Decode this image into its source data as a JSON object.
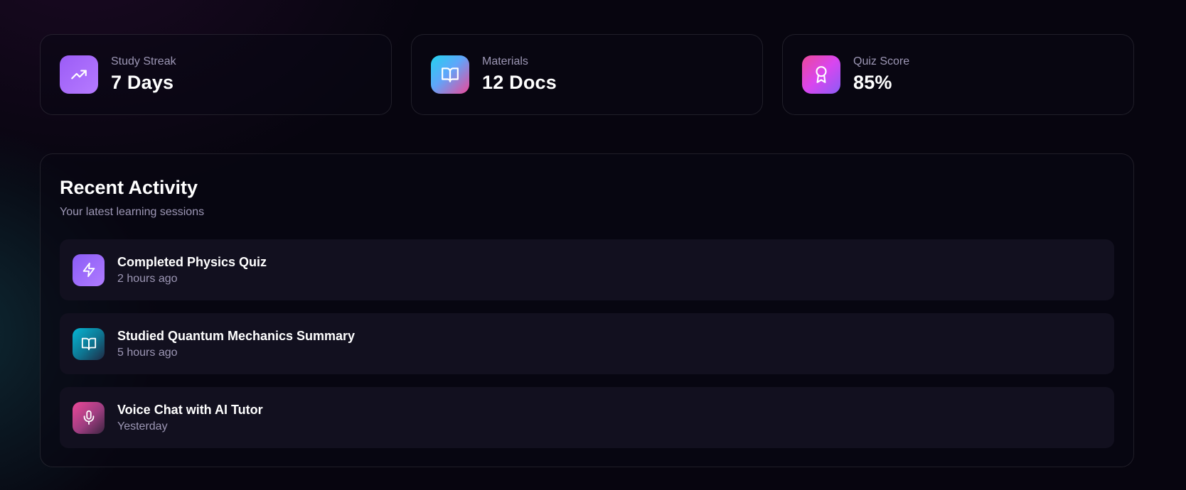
{
  "stats": [
    {
      "label": "Study Streak",
      "value": "7 Days",
      "icon": "trending-up-icon"
    },
    {
      "label": "Materials",
      "value": "12 Docs",
      "icon": "book-open-icon"
    },
    {
      "label": "Quiz Score",
      "value": "85%",
      "icon": "award-icon"
    }
  ],
  "recent_activity": {
    "title": "Recent Activity",
    "subtitle": "Your latest learning sessions",
    "items": [
      {
        "title": "Completed Physics Quiz",
        "time": "2 hours ago",
        "icon": "lightning-icon"
      },
      {
        "title": "Studied Quantum Mechanics Summary",
        "time": "5 hours ago",
        "icon": "book-open-icon"
      },
      {
        "title": "Voice Chat with AI Tutor",
        "time": "Yesterday",
        "icon": "microphone-icon"
      }
    ]
  },
  "colors": {
    "background": "#07050f",
    "card_background": "#12101f",
    "accent_purple": "#9b5cf6",
    "accent_cyan": "#22d3ee",
    "accent_pink": "#ec4899",
    "muted_text": "#9d97b5"
  }
}
